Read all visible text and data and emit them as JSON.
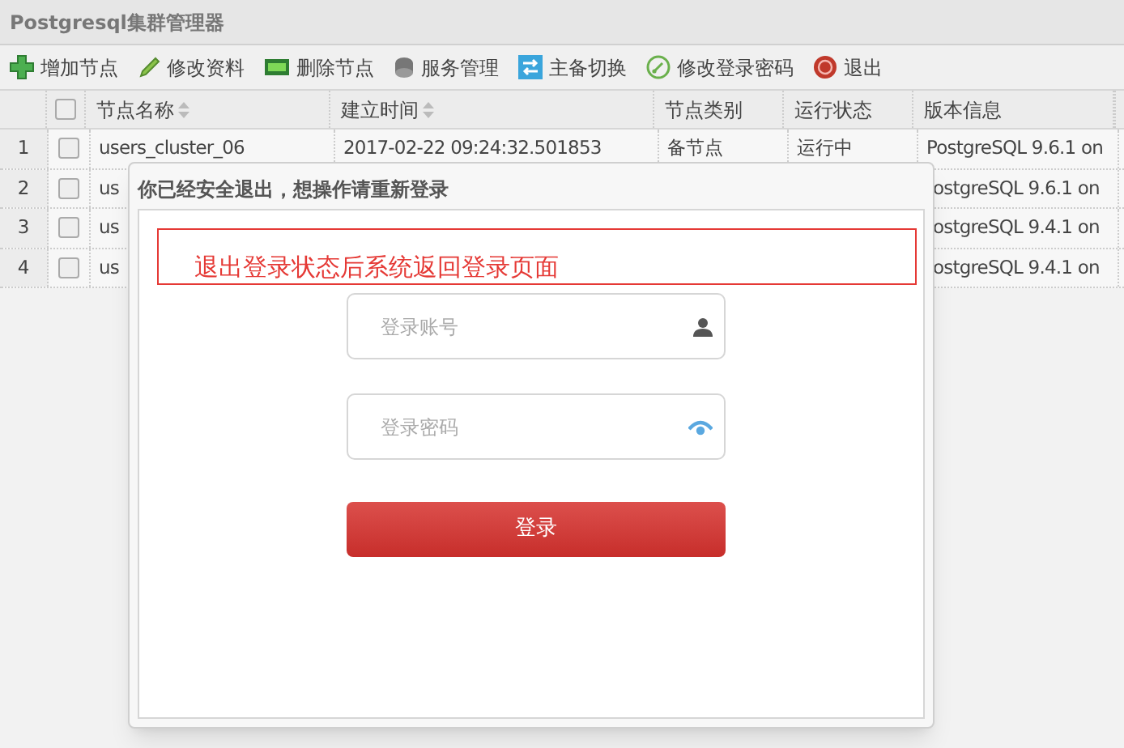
{
  "window": {
    "title": "Postgresql集群管理器"
  },
  "toolbar": [
    {
      "kind": "add",
      "label": "增加节点"
    },
    {
      "kind": "edit",
      "label": "修改资料"
    },
    {
      "kind": "delete",
      "label": "删除节点"
    },
    {
      "kind": "service",
      "label": "服务管理"
    },
    {
      "kind": "switch",
      "label": "主备切换"
    },
    {
      "kind": "password",
      "label": "修改登录密码"
    },
    {
      "kind": "exit",
      "label": "退出"
    }
  ],
  "table": {
    "header_checked": false,
    "columns": [
      "节点名称",
      "建立时间",
      "节点类别",
      "运行状态",
      "版本信息"
    ],
    "rows": [
      {
        "number": "1",
        "checked": false,
        "cells": [
          "users_cluster_06",
          "2017-02-22 09:24:32.501853",
          "备节点",
          "运行中",
          "PostgreSQL 9.6.1 on"
        ]
      },
      {
        "number": "2",
        "checked": false,
        "cells": [
          "us",
          "",
          "",
          "",
          "ostgreSQL 9.6.1 on"
        ]
      },
      {
        "number": "3",
        "checked": false,
        "cells": [
          "us",
          "",
          "",
          "",
          "ostgreSQL 9.4.1 on"
        ]
      },
      {
        "number": "4",
        "checked": false,
        "cells": [
          "us",
          "",
          "",
          "",
          "ostgreSQL 9.4.1 on"
        ]
      }
    ]
  },
  "dialog": {
    "title": "你已经安全退出，想操作请重新登录",
    "notice": "退出登录状态后系统返回登录页面",
    "account": {
      "placeholder": "登录账号"
    },
    "password": {
      "placeholder": "登录密码"
    },
    "button": "登录"
  }
}
